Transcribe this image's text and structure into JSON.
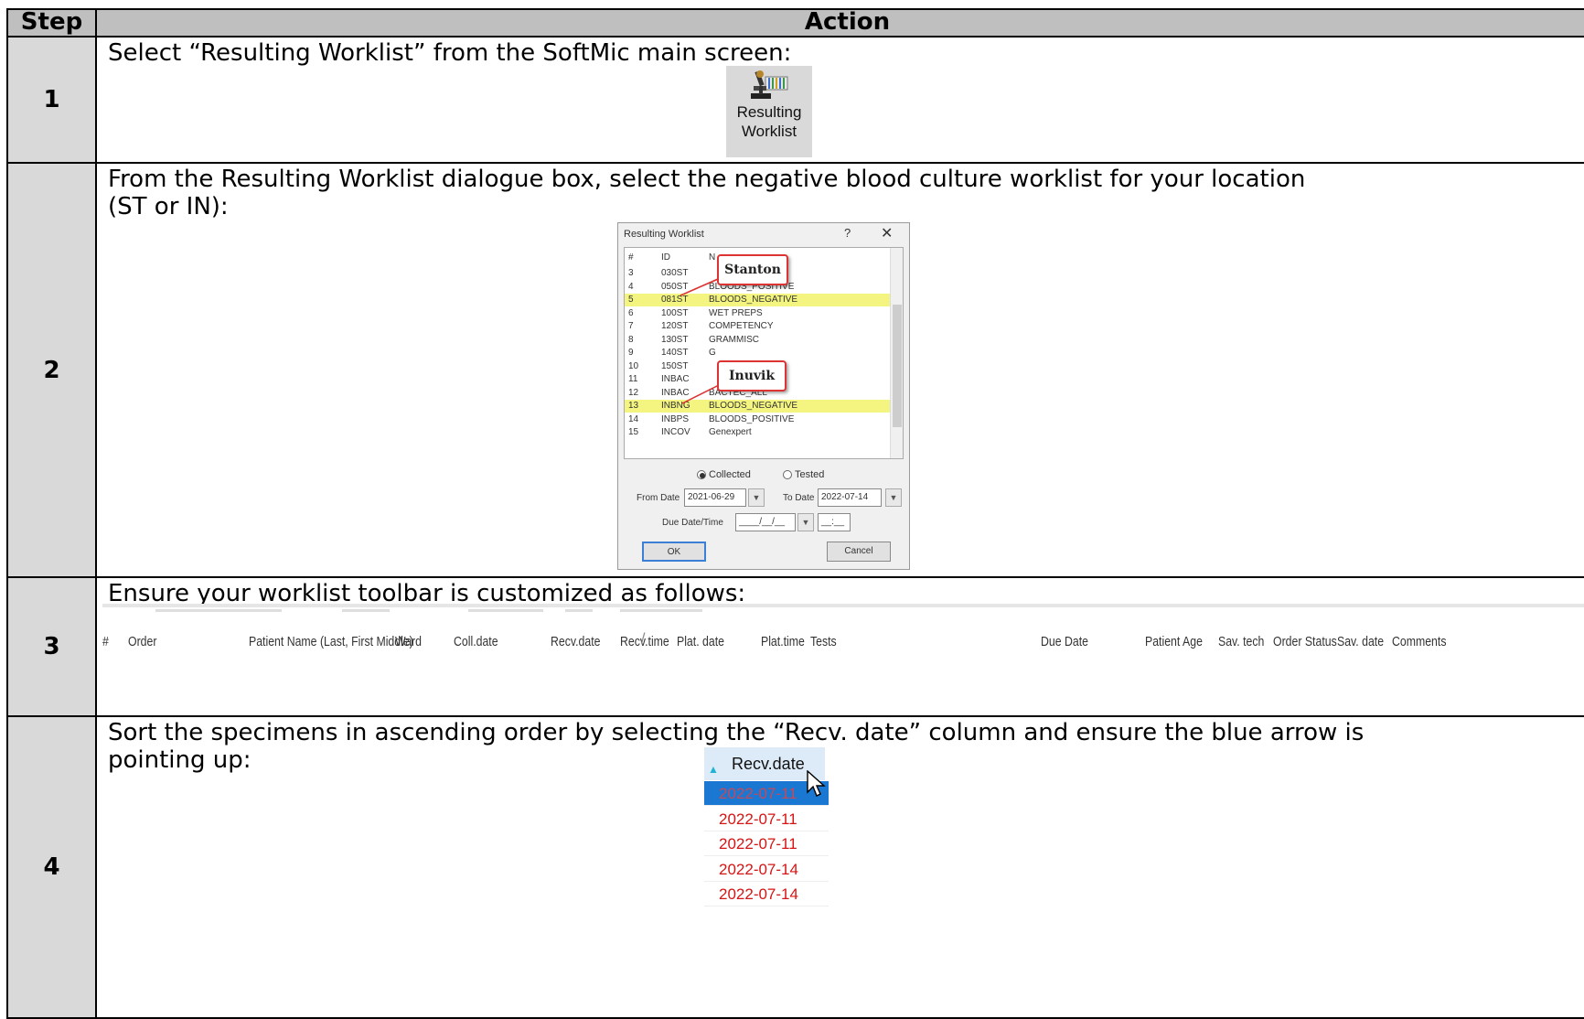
{
  "table": {
    "header_step": "Step",
    "header_action": "Action"
  },
  "steps": [
    {
      "number": "1",
      "text": "Select “Resulting Worklist” from the SoftMic main screen:",
      "icon_label_1": "Resulting",
      "icon_label_2": "Worklist"
    },
    {
      "number": "2",
      "text_line1": "From the Resulting Worklist dialogue box, select the negative blood culture worklist for your location",
      "text_line2": "(ST or IN):",
      "dialog": {
        "title": "Resulting Worklist",
        "help": "?",
        "close": "✕",
        "col_num": "#",
        "col_id": "ID",
        "col_name": "N",
        "rows": [
          {
            "n": "3",
            "id": "030ST",
            "name": ""
          },
          {
            "n": "4",
            "id": "050ST",
            "name": "BLOODS_POSITIVE"
          },
          {
            "n": "5",
            "id": "081ST",
            "name": "BLOODS_NEGATIVE",
            "highlight": true
          },
          {
            "n": "6",
            "id": "100ST",
            "name": "WET PREPS"
          },
          {
            "n": "7",
            "id": "120ST",
            "name": "COMPETENCY"
          },
          {
            "n": "8",
            "id": "130ST",
            "name": "GRAMMISC"
          },
          {
            "n": "9",
            "id": "140ST",
            "name": "G"
          },
          {
            "n": "10",
            "id": "150ST",
            "name": ""
          },
          {
            "n": "11",
            "id": "INBAC",
            "name": ""
          },
          {
            "n": "12",
            "id": "INBAC",
            "name": "BACTEC_ALL"
          },
          {
            "n": "13",
            "id": "INBNG",
            "name": "BLOODS_NEGATIVE",
            "highlight": true
          },
          {
            "n": "14",
            "id": "INBPS",
            "name": "BLOODS_POSITIVE"
          },
          {
            "n": "15",
            "id": "INCOV",
            "name": "Genexpert"
          }
        ],
        "callout_1": "Stanton",
        "callout_2": "Inuvik",
        "radio_1": "Collected",
        "radio_2": "Tested",
        "from_label": "From Date",
        "from_value": "2021-06-29",
        "to_label": "To Date",
        "to_value": "2022-07-14",
        "due_label": "Due Date/Time",
        "due_value": "____/__/__",
        "due_time": "__:__",
        "ok": "OK",
        "cancel": "Cancel"
      }
    },
    {
      "number": "3",
      "text": "Ensure your worklist toolbar is customized as follows:",
      "columns": [
        "#",
        "Order",
        "Patient Name (Last, First Middle)",
        "Ward",
        "Coll.date",
        "Recv.date",
        "Recv.time",
        "Plat. date",
        "Plat.time",
        "Tests",
        "Due Date",
        "Patient Age",
        "Sav. tech",
        "Order Status",
        "Sav. date",
        "Comments"
      ]
    },
    {
      "number": "4",
      "text_line1": "Sort the specimens in ascending order by selecting the “Recv. date” column and ensure the blue arrow is",
      "text_line2": "pointing up:",
      "sort_header": "Recv.date",
      "sort_values": [
        "2022-07-11",
        "2022-07-11",
        "2022-07-11",
        "2022-07-14",
        "2022-07-14"
      ]
    }
  ],
  "colors": {
    "header_bg": "#bfbfbf",
    "step_bg": "#d9d9d9",
    "highlight": "#f4f580",
    "callout_border": "#d33333",
    "sort_arrow": "#1fb3d6",
    "date_red": "#d61414",
    "selection_blue": "#1a77d2"
  },
  "icons": [
    "microscope-worklist-icon",
    "help-icon",
    "close-icon",
    "sort-ascending-icon",
    "mouse-cursor-icon"
  ]
}
